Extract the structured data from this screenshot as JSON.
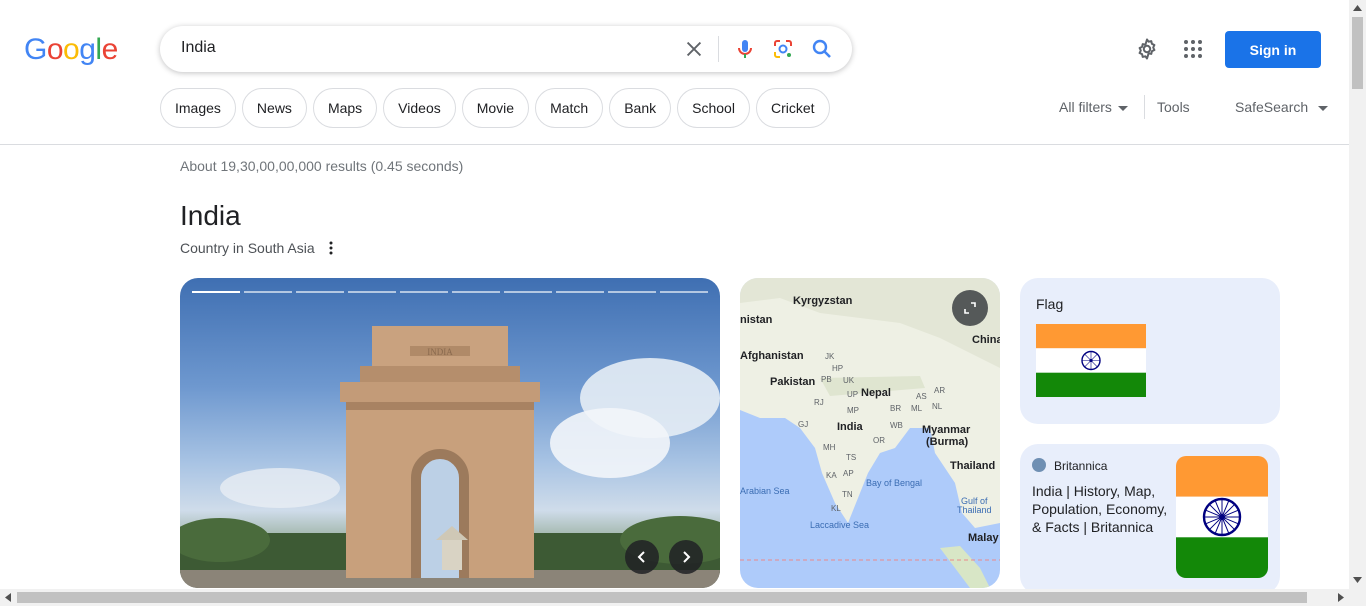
{
  "logo": {
    "letters": [
      "G",
      "o",
      "o",
      "g",
      "l",
      "e"
    ],
    "colors": [
      "#4285F4",
      "#EA4335",
      "#FBBC05",
      "#4285F4",
      "#34A853",
      "#EA4335"
    ]
  },
  "search": {
    "query": "India"
  },
  "header": {
    "sign_in": "Sign in"
  },
  "chips": [
    "Images",
    "News",
    "Maps",
    "Videos",
    "Movie",
    "Match",
    "Bank",
    "School",
    "Cricket"
  ],
  "toolbar": {
    "all_filters": "All filters",
    "tools": "Tools",
    "safesearch": "SafeSearch"
  },
  "results": {
    "stats": "About 19,30,00,00,000 results (0.45 seconds)"
  },
  "knowledge_panel": {
    "title": "India",
    "subtitle": "Country in South Asia",
    "photo_inscription": "INDIA",
    "map_labels": {
      "kyrgyzstan": "Kyrgyzstan",
      "tajikistan": "nistan",
      "china": "China",
      "afghanistan": "Afghanistan",
      "pakistan": "Pakistan",
      "nepal": "Nepal",
      "india": "India",
      "myanmar": "Myanmar",
      "burma": "(Burma)",
      "thailand": "Thailand",
      "arabian_sea": "Arabian Sea",
      "bay_of_bengal": "Bay of Bengal",
      "laccadive_sea": "Laccadive Sea",
      "gulf_of_thailand_1": "Gulf of",
      "gulf_of_thailand_2": "Thailand",
      "malaysia": "Malay",
      "states": [
        "JK",
        "HP",
        "PB",
        "UK",
        "UP",
        "RJ",
        "BR",
        "ML",
        "NL",
        "AR",
        "AS",
        "GJ",
        "MP",
        "WB",
        "OR",
        "MH",
        "TS",
        "AP",
        "KA",
        "TN",
        "KL"
      ]
    },
    "flag_card": {
      "title": "Flag"
    },
    "britannica": {
      "source": "Britannica",
      "text": "India | History, Map, Population, Economy, & Facts | Britannica"
    }
  },
  "colors": {
    "accent": "#1a73e8",
    "saffron": "#FF9933",
    "green": "#138808",
    "chakra": "#000080"
  }
}
